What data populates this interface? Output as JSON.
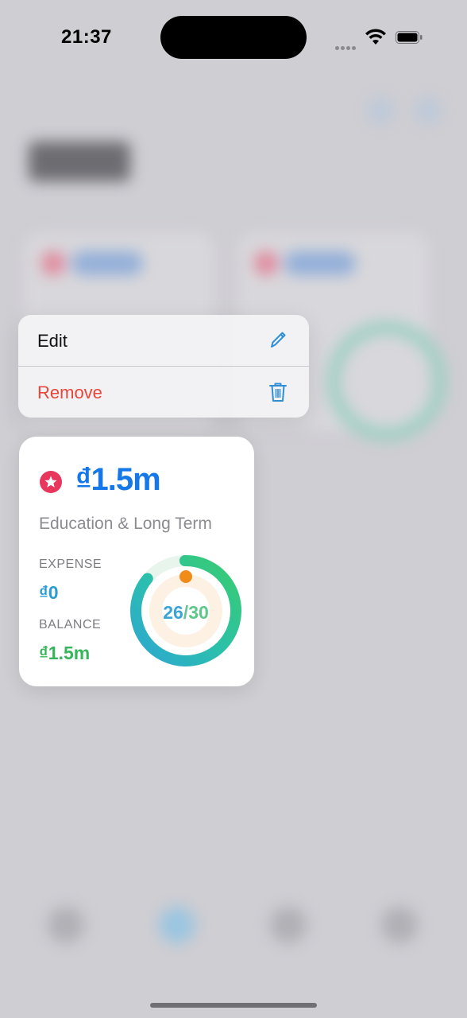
{
  "status_bar": {
    "time": "21:37"
  },
  "context_menu": {
    "items": [
      {
        "label": "Edit",
        "icon": "pencil-icon"
      },
      {
        "label": "Remove",
        "icon": "trash-icon"
      }
    ]
  },
  "goal_card": {
    "amount": "₫1.5m",
    "name": "Education & Long Term",
    "expense_label": "EXPENSE",
    "expense_value": "₫0",
    "balance_label": "BALANCE",
    "balance_value": "₫1.5m",
    "days_current": "26",
    "days_separator": "/",
    "days_total": "30",
    "colors": {
      "amount": "#1677e8",
      "expense": "#2a9bd4",
      "balance": "#36b65a",
      "badge": "#e8365d",
      "progress_dot": "#f08c1a"
    }
  }
}
